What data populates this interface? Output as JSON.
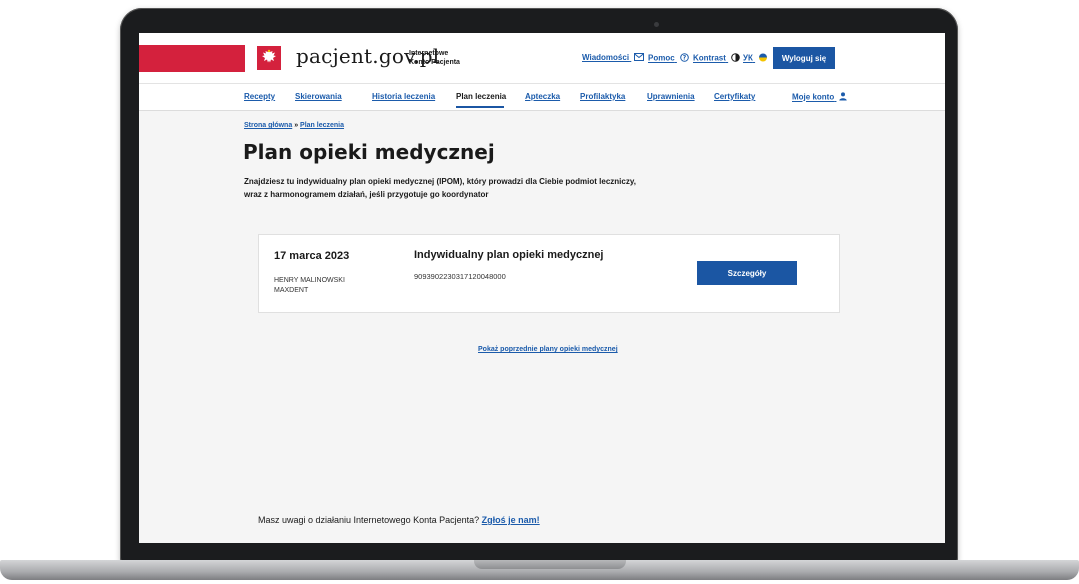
{
  "header": {
    "brand": "pacjent.gov.pl",
    "brand_sub_1": "Internetowe",
    "brand_sub_2": "Konto Pacjenta",
    "links": {
      "messages": "Wiadomości",
      "help": "Pomoc",
      "contrast": "Kontrast",
      "language": "УК"
    },
    "logout_label": "Wyloguj się"
  },
  "nav": {
    "items": [
      "Recepty",
      "Skierowania",
      "Historia leczenia",
      "Plan leczenia",
      "Apteczka",
      "Profilaktyka",
      "Uprawnienia",
      "Certyfikaty"
    ],
    "active_index": 3,
    "account": "Moje konto"
  },
  "breadcrumb": {
    "home": "Strona główna",
    "separator": "»",
    "current": "Plan leczenia"
  },
  "page": {
    "title": "Plan opieki medycznej",
    "intro_line1": "Znajdziesz tu indywidualny plan opieki medycznej (IPOM), który prowadzi dla Ciebie podmiot leczniczy,",
    "intro_line2": "wraz z harmonogramem działań, jeśli przygotuje go koordynator"
  },
  "plan_card": {
    "date": "17 marca 2023",
    "doctor_name": "HENRY MALINOWSKI",
    "facility": "MAXDENT",
    "title": "Indywidualny plan opieki medycznej",
    "plan_id": "9093902230317120048000",
    "details_label": "Szczegóły"
  },
  "more_link": "Pokaż poprzednie plany opieki medycznej",
  "feedback": {
    "text": "Masz uwagi o działaniu Internetowego Konta Pacjenta?",
    "link": "Zgłoś je nam!"
  },
  "colors": {
    "brand_red": "#d4213d",
    "link_blue": "#1b5bab",
    "button_blue": "#1b56a3"
  },
  "icons": [
    "polish-eagle-emblem",
    "envelope-icon",
    "help-circle-icon",
    "contrast-icon",
    "ukraine-flag-icon",
    "user-icon"
  ]
}
